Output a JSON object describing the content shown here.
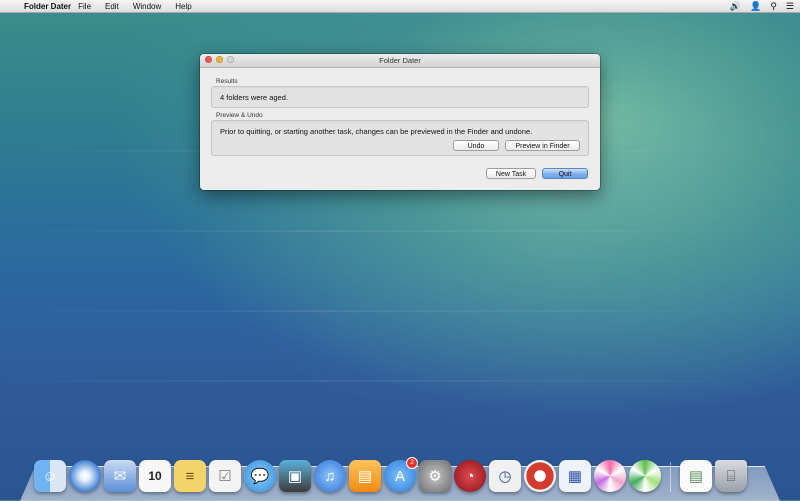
{
  "menubar": {
    "app_name": "Folder Dater",
    "items": [
      "File",
      "Edit",
      "Window",
      "Help"
    ],
    "status_icons": [
      "volume-icon",
      "user-icon",
      "spotlight-icon",
      "notification-center-icon"
    ]
  },
  "window": {
    "title": "Folder Dater",
    "results": {
      "label": "Results",
      "text": "4 folders were aged."
    },
    "preview": {
      "label": "Preview & Undo",
      "text": "Prior to quitting, or starting another task, changes can be previewed in the Finder and undone.",
      "undo_button": "Undo",
      "preview_button": "Preview in Finder"
    },
    "new_task_button": "New Task",
    "quit_button": "Quit"
  },
  "dock": {
    "apps": [
      {
        "icon": "finder-icon",
        "color": "#4a8fe0"
      },
      {
        "icon": "safari-icon",
        "color": "#3f7fd0"
      },
      {
        "icon": "mail-icon",
        "color": "#5a8fd8"
      },
      {
        "icon": "calendar-icon",
        "color": "#f4f4f4",
        "text": "10"
      },
      {
        "icon": "notes-icon",
        "color": "#f3d36a"
      },
      {
        "icon": "reminders-icon",
        "color": "#f0f0f0"
      },
      {
        "icon": "messages-icon",
        "color": "#49a6ea"
      },
      {
        "icon": "photo-booth-icon",
        "color": "#3d3d3d"
      },
      {
        "icon": "itunes-icon",
        "color": "#3b78d8"
      },
      {
        "icon": "ibooks-icon",
        "color": "#f29a20"
      },
      {
        "icon": "app-store-icon",
        "color": "#3b8de6",
        "badge": "2"
      },
      {
        "icon": "system-preferences-icon",
        "color": "#7d7d7d"
      },
      {
        "icon": "app-red-icon",
        "color": "#b0202a"
      },
      {
        "icon": "clock-app-icon",
        "color": "#e8e8e8"
      },
      {
        "icon": "lifesaver-app-icon",
        "color": "#d73a2e"
      },
      {
        "icon": "date-app-icon",
        "color": "#e8eef8"
      },
      {
        "icon": "candy-swirl-icon",
        "color": "#f0a3c8"
      },
      {
        "icon": "candy-swirl-green-icon",
        "color": "#8ccf6b"
      }
    ],
    "extras": [
      {
        "icon": "document-icon",
        "color": "#f7f7f7"
      },
      {
        "icon": "trash-icon",
        "color": "#bfc4ca"
      }
    ]
  }
}
